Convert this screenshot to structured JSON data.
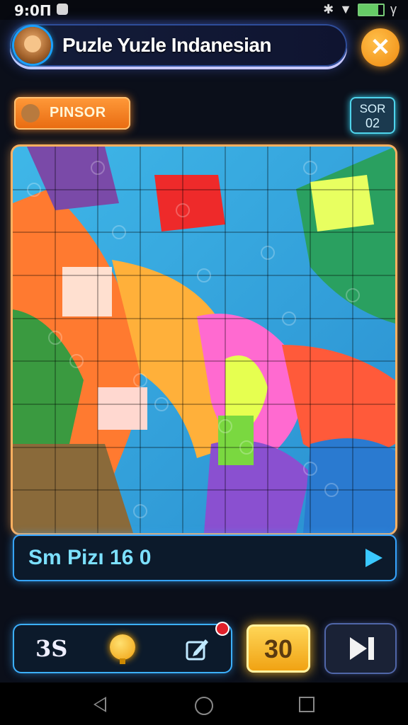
{
  "status_bar": {
    "time": "9:0П",
    "battery_label": "γ"
  },
  "header": {
    "title": "Puzle Yuzle Indanesian",
    "close_icon": "close-icon",
    "avatar_icon": "monkey-avatar-icon"
  },
  "category_button": {
    "label": "PINSOR",
    "icon": "monkey-icon"
  },
  "score_box": {
    "line1": "SOR",
    "line2": "02"
  },
  "progress": {
    "label": "Sm Pizı 16 0",
    "arrow_icon": "play-arrow-icon"
  },
  "tools": {
    "count_label": "3S",
    "hint_icon": "lightbulb-icon",
    "edit_icon": "edit-icon"
  },
  "counter": {
    "value": "30"
  },
  "next_button": {
    "icon": "skip-next-icon"
  },
  "nav": {
    "back": "back-icon",
    "home": "home-icon",
    "recent": "recent-apps-icon"
  },
  "colors": {
    "accent_blue": "#36a4ff",
    "accent_orange": "#ff9a3a",
    "counter_gold": "#ffd85a"
  }
}
